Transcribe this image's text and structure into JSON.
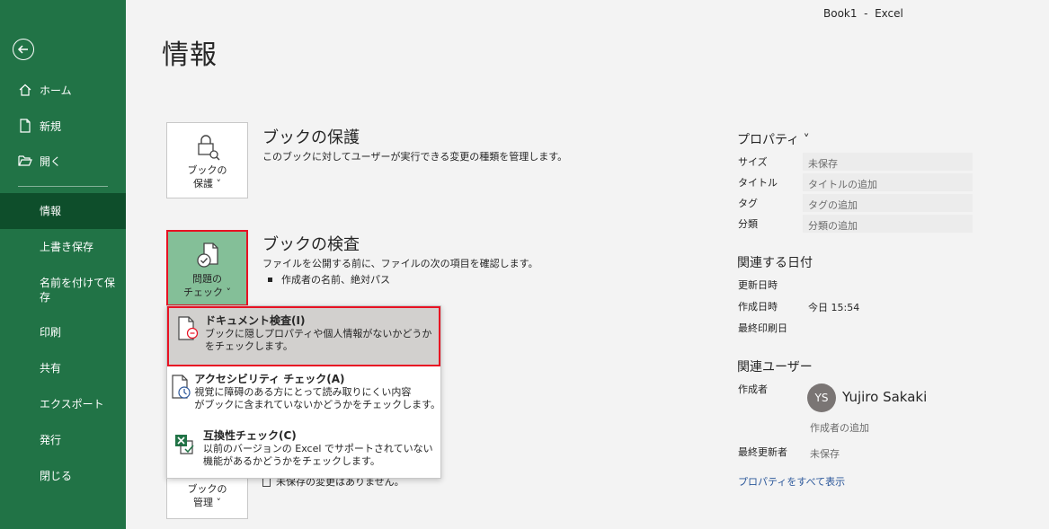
{
  "window": {
    "title": "Book1  -  Excel"
  },
  "sidebar": {
    "back_icon": "arrow-left-icon",
    "primary": [
      {
        "label": "ホーム",
        "icon": "home-icon"
      },
      {
        "label": "新規",
        "icon": "new-file-icon"
      },
      {
        "label": "開く",
        "icon": "folder-open-icon"
      }
    ],
    "secondary": [
      {
        "label": "情報"
      },
      {
        "label": "上書き保存"
      },
      {
        "label": "名前を付けて保存"
      },
      {
        "label": "印刷"
      },
      {
        "label": "共有"
      },
      {
        "label": "エクスポート"
      },
      {
        "label": "発行"
      },
      {
        "label": "閉じる"
      }
    ],
    "active_color": "#0e4e2b",
    "bg_color": "#217346"
  },
  "main": {
    "title": "情報",
    "protect": {
      "tile_label_1": "ブックの",
      "tile_label_2": "保護 ˅",
      "title": "ブックの保護",
      "desc": "このブックに対してユーザーが実行できる変更の種類を管理します。"
    },
    "inspect": {
      "tile_label_1": "問題の",
      "tile_label_2": "チェック ˅",
      "title": "ブックの検査",
      "desc": "ファイルを公開する前に、ファイルの次の項目を確認します。",
      "bullet": "作成者の名前、絶対パス"
    },
    "manage": {
      "tile_label_1": "ブックの",
      "tile_label_2": "管理 ˅",
      "desc_partial": "未保存の変更はありません。"
    }
  },
  "dropdown": {
    "items": [
      {
        "title": "ドキュメント検査(I)",
        "desc1": "ブックに隠しプロパティや個人情報がないかどうか",
        "desc2": "をチェックします。",
        "icon": "document-inspect-icon"
      },
      {
        "title": "アクセシビリティ チェック(A)",
        "desc1": "視覚に障碍のある方にとって読み取りにくい内容",
        "desc2": "がブックに含まれていないかどうかをチェックします。",
        "icon": "accessibility-check-icon"
      },
      {
        "title": "互換性チェック(C)",
        "desc1": "以前のバージョンの Excel でサポートされていない",
        "desc2": "機能があるかどうかをチェックします。",
        "icon": "compatibility-check-icon"
      }
    ]
  },
  "properties": {
    "heading": "プロパティ ˅",
    "rows": [
      {
        "label": "サイズ",
        "value": "未保存"
      },
      {
        "label": "タイトル",
        "value": "タイトルの追加"
      },
      {
        "label": "タグ",
        "value": "タグの追加"
      },
      {
        "label": "分類",
        "value": "分類の追加"
      }
    ],
    "dates_heading": "関連する日付",
    "dates": [
      {
        "label": "更新日時",
        "value": ""
      },
      {
        "label": "作成日時",
        "value": "今日 15:54"
      },
      {
        "label": "最終印刷日",
        "value": ""
      }
    ],
    "users_heading": "関連ユーザー",
    "author_label": "作成者",
    "author_initials": "YS",
    "author_name": "Yujiro Sakaki",
    "add_author": "作成者の追加",
    "last_modified_label": "最終更新者",
    "last_modified_value": "未保存",
    "show_all": "プロパティをすべて表示"
  }
}
